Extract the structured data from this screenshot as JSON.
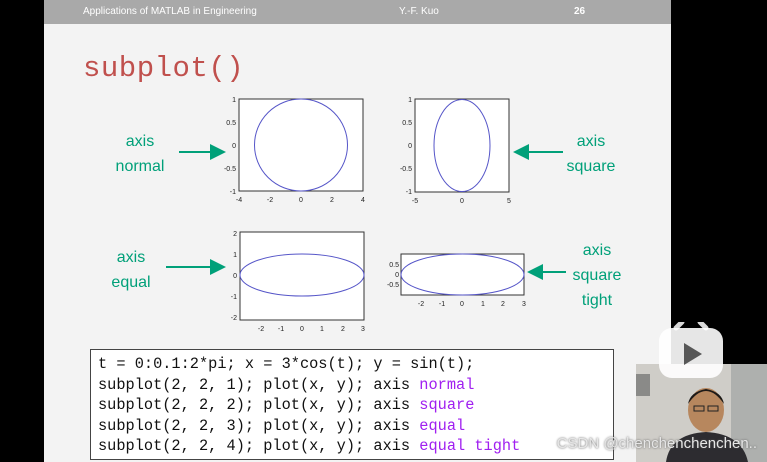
{
  "header": {
    "course": "Applications of MATLAB in Engineering",
    "author": "Y.-F. Kuo",
    "page": "26"
  },
  "title": "subplot()",
  "labels": {
    "normal": [
      "axis",
      "normal"
    ],
    "square": [
      "axis",
      "square"
    ],
    "equal": [
      "axis",
      "equal"
    ],
    "tight": [
      "axis",
      "square",
      "tight"
    ]
  },
  "plots": {
    "normal": {
      "xticks": [
        "-4",
        "-2",
        "0",
        "2",
        "4"
      ],
      "yticks": [
        "1",
        "0.5",
        "0",
        "-0.5",
        "-1"
      ]
    },
    "square": {
      "xticks": [
        "-5",
        "0",
        "5"
      ],
      "yticks": [
        "1",
        "0.5",
        "0",
        "-0.5",
        "-1"
      ]
    },
    "equal": {
      "xticks": [
        "-2",
        "-1",
        "0",
        "1",
        "2",
        "3"
      ],
      "yticks": [
        "2",
        "1",
        "0",
        "-1",
        "-2"
      ]
    },
    "tight": {
      "xticks": [
        "-2",
        "-1",
        "0",
        "1",
        "2",
        "3"
      ],
      "yticks": [
        "0.5",
        "0",
        "-0.5"
      ]
    }
  },
  "code": {
    "line1": "t = 0:0.1:2*pi; x = 3*cos(t); y = sin(t);",
    "prefix": "subplot(2, 2, %); plot(x, y); axis ",
    "prefixes": [
      "subplot(2, 2, 1); plot(x, y); axis ",
      "subplot(2, 2, 2); plot(x, y); axis ",
      "subplot(2, 2, 3); plot(x, y); axis ",
      "subplot(2, 2, 4); plot(x, y); axis "
    ],
    "keywords": [
      "normal",
      "square",
      "equal",
      "equal tight"
    ]
  },
  "watermark": "CSDN @chenchenchenchen..",
  "colors": {
    "title": "#c0504d",
    "label": "#00a079",
    "curve": "#5555c8",
    "keyword": "#a020f0",
    "header": "#a9a9a9"
  }
}
